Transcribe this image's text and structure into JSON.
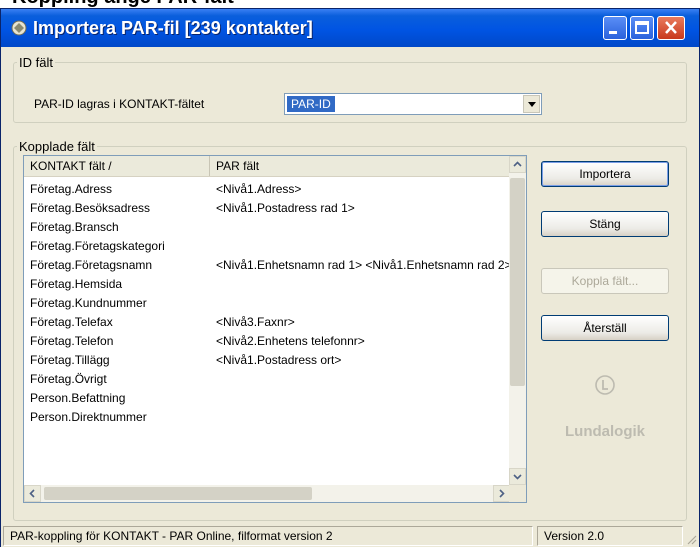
{
  "page_heading": "Koppling ange PAR-fält",
  "window": {
    "title": "Importera PAR-fil [239 kontakter]",
    "app_icon": "app-icon",
    "controls": [
      "minimize-icon",
      "maximize-icon",
      "close-icon"
    ]
  },
  "id_group": {
    "legend": "ID fält",
    "label": "PAR-ID lagras i KONTAKT-fältet",
    "selected": "PAR-ID"
  },
  "linked_group": {
    "legend": "Kopplade fält",
    "columns": [
      "KONTAKT fält /",
      "PAR fält"
    ],
    "rows": [
      {
        "kontakt": "Företag.Adress",
        "par": "<Nivå1.Adress>"
      },
      {
        "kontakt": "Företag.Besöksadress",
        "par": "<Nivå1.Postadress rad 1>"
      },
      {
        "kontakt": "Företag.Bransch",
        "par": ""
      },
      {
        "kontakt": "Företag.Företagskategori",
        "par": ""
      },
      {
        "kontakt": "Företag.Företagsnamn",
        "par": "<Nivå1.Enhetsnamn rad 1> <Nivå1.Enhetsnamn rad 2>"
      },
      {
        "kontakt": "Företag.Hemsida",
        "par": ""
      },
      {
        "kontakt": "Företag.Kundnummer",
        "par": ""
      },
      {
        "kontakt": "Företag.Telefax",
        "par": "<Nivå3.Faxnr>"
      },
      {
        "kontakt": "Företag.Telefon",
        "par": "<Nivå2.Enhetens telefonnr>"
      },
      {
        "kontakt": "Företag.Tillägg",
        "par": "<Nivå1.Postadress ort>"
      },
      {
        "kontakt": "Företag.Övrigt",
        "par": ""
      },
      {
        "kontakt": "Person.Befattning",
        "par": ""
      },
      {
        "kontakt": "Person.Direktnummer",
        "par": ""
      }
    ]
  },
  "buttons": {
    "import": "Importera",
    "close": "Stäng",
    "link_field": "Koppla fält...",
    "reset": "Återställ"
  },
  "logo": "Lundalogik",
  "statusbar": {
    "message": "PAR-koppling för KONTAKT - PAR Online, filformat version 2",
    "version": "Version 2.0"
  }
}
